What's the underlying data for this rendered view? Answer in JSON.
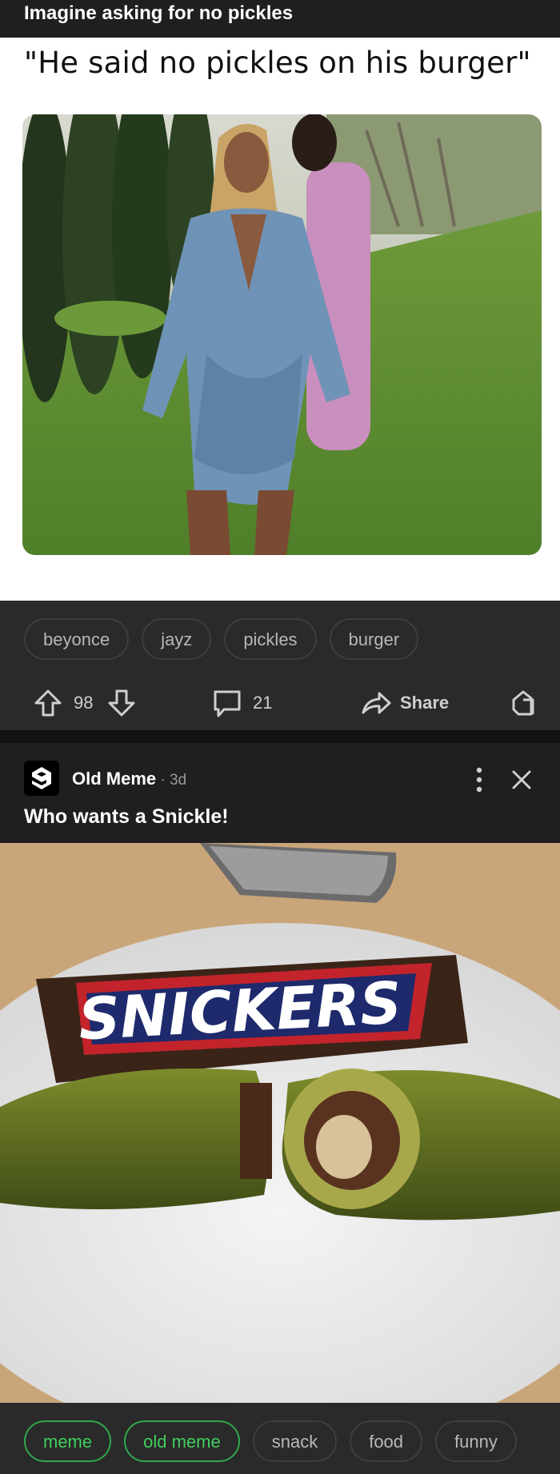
{
  "post1": {
    "title": "Imagine asking for no pickles",
    "caption": "\"He said no pickles on his burger\"",
    "tags": [
      "beyonce",
      "jayz",
      "pickles",
      "burger"
    ],
    "upvotes": "98",
    "comments": "21",
    "share_label": "Share"
  },
  "post2": {
    "author": "Old Meme",
    "age": "3d",
    "title": "Who wants a Snickle!",
    "wrapper_text": "SNICKERS",
    "tags": [
      {
        "label": "meme",
        "highlighted": true
      },
      {
        "label": "old meme",
        "highlighted": true
      },
      {
        "label": "snack",
        "highlighted": false
      },
      {
        "label": "food",
        "highlighted": false
      },
      {
        "label": "funny",
        "highlighted": false
      }
    ]
  },
  "colors": {
    "background": "#1f1f1f",
    "bar": "#2a2a2a",
    "tag_green": "#3fcf5c"
  }
}
